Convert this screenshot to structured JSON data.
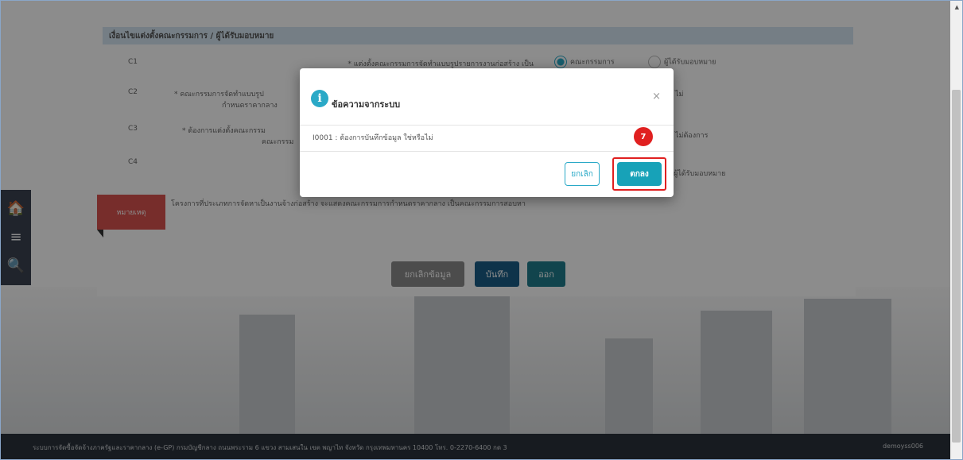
{
  "background": {
    "section_title": "เงื่อนไขแต่งตั้งคณะกรรมการ / ผู้ได้รับมอบหมาย",
    "rows": [
      {
        "code": "C1",
        "label": "* แต่งตั้งคณะกรรมการจัดทำแบบรูปรายการงานก่อสร้าง เป็น",
        "option_a": "คณะกรรมการ",
        "option_b": "ผู้ได้รับมอบหมาย"
      },
      {
        "code": "C2",
        "label": "* คณะกรรมการจัดทำแบบรูป",
        "label2": "กำหนดราคากลาง",
        "tail": "ไม่"
      },
      {
        "code": "C3",
        "label": "* ต้องการแต่งตั้งคณะกรรม",
        "label2": "คณะกรรม",
        "tail": "ไม่ต้องการ"
      },
      {
        "code": "C4",
        "tail": "ผู้ได้รับมอบหมาย"
      }
    ],
    "remark_label": "หมายเหตุ",
    "remark_text": "โครงการที่ประเภทการจัดหาเป็นงานจ้างก่อสร้าง จะแสดงคณะกรรมการกำหนดราคากลาง เป็นคณะกรรมการสอบหา",
    "buttons": {
      "clear": "ยกเลิกข้อมูล",
      "save": "บันทึก",
      "exit": "ออก"
    },
    "footer_text": "ระบบการจัดซื้อจัดจ้างภาครัฐและราคากลาง (e-GP) กรมบัญชีกลาง ถนนพระราม 6 แขวง สามเสนใน เขต พญาไท จังหวัด กรุงเทพมหานคร 10400 โทร. 0-2270-6400 กด 3",
    "footer_user": "demoyss006"
  },
  "modal": {
    "title": "ข้อความจากระบบ",
    "message": "I0001 : ต้องการบันทึกข้อมูล ใช่หรือไม่",
    "cancel_label": "ยกเลิก",
    "ok_label": "ตกลง",
    "close_symbol": "×",
    "info_symbol": "i"
  },
  "annotation": {
    "step": "7"
  },
  "side_nav": {
    "home_symbol": "🏠",
    "menu_symbol": "≡",
    "search_symbol": "🔍"
  },
  "colors": {
    "accent": "#2aa9c7",
    "ok": "#17a2b8",
    "highlight": "#e02020",
    "remark": "#d9534f"
  }
}
